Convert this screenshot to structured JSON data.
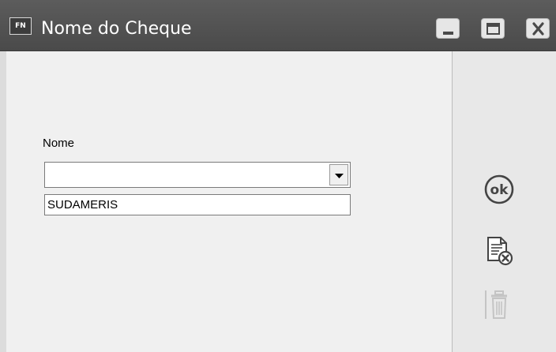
{
  "window": {
    "app_badge": "FN",
    "title": "Nome do Cheque",
    "controls": [
      "minimize-icon",
      "maximize-icon",
      "close-icon"
    ]
  },
  "form": {
    "field_label": "Nome",
    "combo_value": "",
    "list_items": [
      "SUDAMERIS"
    ]
  },
  "side_actions": [
    {
      "icon": "ok-icon",
      "label": "ok",
      "enabled": true
    },
    {
      "icon": "cancel-document-icon",
      "enabled": true
    },
    {
      "icon": "trash-icon",
      "enabled": false
    }
  ],
  "colors": {
    "titlebar": "#4e4e4e",
    "background": "#f0f0f0",
    "side_panel": "#e8e8e8",
    "icon": "#444444",
    "icon_disabled": "#c4c4c4"
  }
}
